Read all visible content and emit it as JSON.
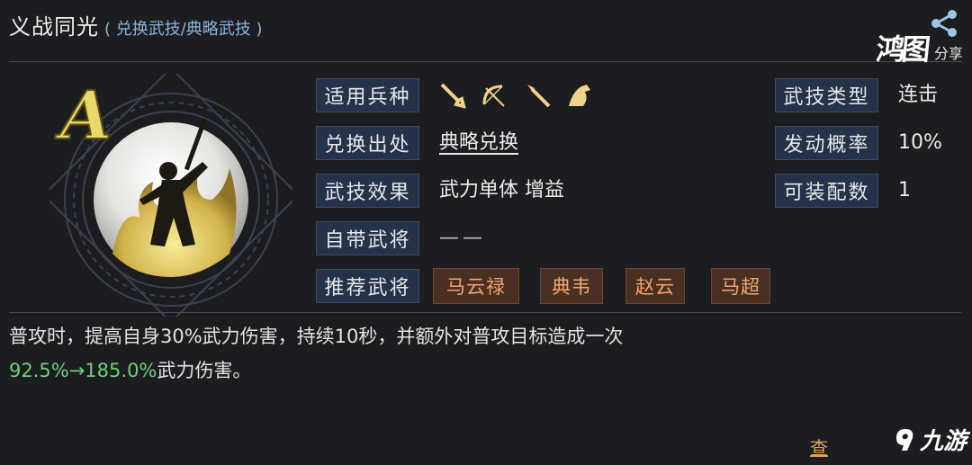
{
  "header": {
    "title": "义战同光",
    "subtitle": "( 兑换武技/典略武技 )"
  },
  "watermark": {
    "brand": "鸿图",
    "share_label": "分享",
    "share_icon": "share-icon"
  },
  "skill": {
    "grade": "A",
    "icon": "warrior-sword-emblem",
    "accent_color": "#d8c55a"
  },
  "info": {
    "unit_type": {
      "label": "适用兵种",
      "icons": [
        "sword-icon",
        "bow-icon",
        "spear-icon",
        "horse-icon"
      ]
    },
    "source": {
      "label": "兑换出处",
      "value": "典略兑换"
    },
    "effect": {
      "label": "武技效果",
      "value": "武力单体 增益"
    },
    "own_general": {
      "label": "自带武将",
      "value": "——"
    },
    "recommended": {
      "label": "推荐武将",
      "heroes": [
        "马云禄",
        "典韦",
        "赵云",
        "马超"
      ]
    },
    "skill_type": {
      "label": "武技类型",
      "value": "连击"
    },
    "trigger_rate": {
      "label": "发动概率",
      "value": "10%"
    },
    "equip_count": {
      "label": "可装配数",
      "value": "1"
    }
  },
  "description": {
    "line1": "普攻时，提高自身30%武力伤害，持续10秒，并额外对普攻目标造成一次",
    "green": "92.5%→185.0%",
    "tail": "武力伤害。"
  },
  "footer": {
    "link_text": "查",
    "logo_text": "九游"
  },
  "colors": {
    "label_bg": "#24324a",
    "hero_tag_text": "#f2a56d",
    "highlight_green": "#6ccf7c",
    "subtitle_blue": "#8bb3dd"
  }
}
